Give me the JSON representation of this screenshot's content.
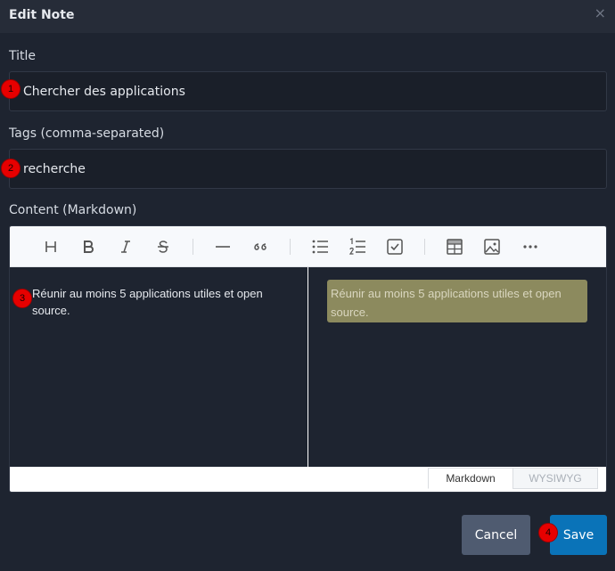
{
  "dialog": {
    "title": "Edit Note",
    "close_glyph": "×"
  },
  "form": {
    "title_label": "Title",
    "title_value": "Chercher des applications",
    "tags_label": "Tags (comma-separated)",
    "tags_value": "recherche",
    "content_label": "Content (Markdown)"
  },
  "editor": {
    "toolbar": [
      {
        "name": "heading-icon"
      },
      {
        "name": "bold-icon"
      },
      {
        "name": "italic-icon"
      },
      {
        "name": "strikethrough-icon"
      },
      {
        "name": "horizontal-rule-icon"
      },
      {
        "name": "quote-icon"
      },
      {
        "name": "bullet-list-icon"
      },
      {
        "name": "numbered-list-icon"
      },
      {
        "name": "task-list-icon"
      },
      {
        "name": "table-icon"
      },
      {
        "name": "image-icon"
      },
      {
        "name": "more-icon"
      }
    ],
    "markdown_text": "Réunir au moins 5 applications utiles et open source.",
    "preview_text": "Réunir au moins 5 applications utiles et open source.",
    "preview_highlight_color": "#8c8a5e",
    "modes": {
      "markdown": "Markdown",
      "wysiwyg": "WYSIWYG"
    }
  },
  "actions": {
    "cancel": "Cancel",
    "save": "Save",
    "save_color": "#0a73b8"
  },
  "badges": [
    "1",
    "2",
    "3",
    "4"
  ]
}
